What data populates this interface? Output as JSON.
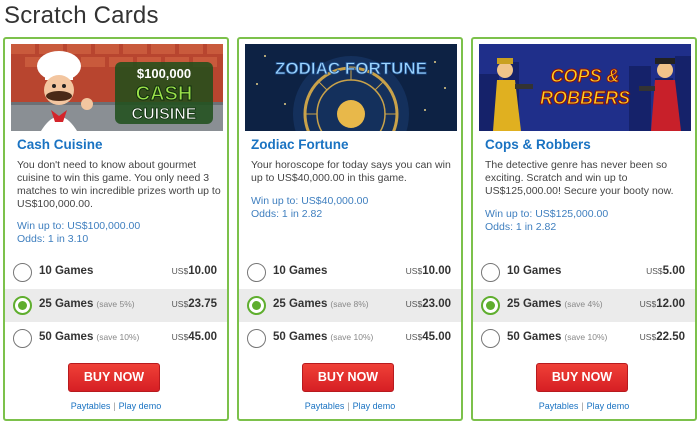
{
  "page": {
    "title": "Scratch Cards"
  },
  "cards": [
    {
      "title": "Cash Cuisine",
      "banner_text": [
        "$100,000",
        "CASH",
        "CUISINE"
      ],
      "description": "You don't need to know about gourmet cuisine to win this game. You only need 3 matches to win incredible prizes worth up to US$100,000.00.",
      "win_up_to": "Win up to: US$100,000.00",
      "odds": "Odds: 1 in 3.10",
      "options": [
        {
          "label": "10 Games",
          "save": "",
          "currency": "US$",
          "price": "10.00",
          "selected": false
        },
        {
          "label": "25 Games",
          "save": "(save 5%)",
          "currency": "US$",
          "price": "23.75",
          "selected": true
        },
        {
          "label": "50 Games",
          "save": "(save 10%)",
          "currency": "US$",
          "price": "45.00",
          "selected": false
        }
      ],
      "buy_label": "BUY NOW",
      "paytables_label": "Paytables",
      "play_demo_label": "Play demo"
    },
    {
      "title": "Zodiac Fortune",
      "banner_text": [
        "ZODIAC FORTUNE"
      ],
      "description": "Your horoscope for today says you can win up to US$40,000.00 in this game.",
      "win_up_to": "Win up to: US$40,000.00",
      "odds": "Odds: 1 in 2.82",
      "options": [
        {
          "label": "10 Games",
          "save": "",
          "currency": "US$",
          "price": "10.00",
          "selected": false
        },
        {
          "label": "25 Games",
          "save": "(save 8%)",
          "currency": "US$",
          "price": "23.00",
          "selected": true
        },
        {
          "label": "50 Games",
          "save": "(save 10%)",
          "currency": "US$",
          "price": "45.00",
          "selected": false
        }
      ],
      "buy_label": "BUY NOW",
      "paytables_label": "Paytables",
      "play_demo_label": "Play demo"
    },
    {
      "title": "Cops & Robbers",
      "banner_text": [
        "COPS &",
        "ROBBERS"
      ],
      "description": "The detective genre has never been so exciting. Scratch and win up to US$125,000.00! Secure your booty now.",
      "win_up_to": "Win up to: US$125,000.00",
      "odds": "Odds: 1 in 2.82",
      "options": [
        {
          "label": "10 Games",
          "save": "",
          "currency": "US$",
          "price": "5.00",
          "selected": false
        },
        {
          "label": "25 Games",
          "save": "(save 4%)",
          "currency": "US$",
          "price": "12.00",
          "selected": true
        },
        {
          "label": "50 Games",
          "save": "(save 10%)",
          "currency": "US$",
          "price": "22.50",
          "selected": false
        }
      ],
      "buy_label": "BUY NOW",
      "paytables_label": "Paytables",
      "play_demo_label": "Play demo"
    }
  ],
  "colors": {
    "card_border": "#7cc14b",
    "title_blue": "#1a73c2",
    "buy_red": "#e02b2b",
    "radio_green": "#5fae2e"
  }
}
